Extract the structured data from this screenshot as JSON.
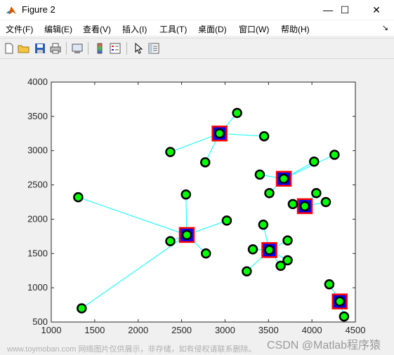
{
  "window": {
    "title": "Figure 2",
    "minimize_glyph": "—",
    "maximize_glyph": "☐",
    "close_glyph": "✕"
  },
  "menu": [
    "文件(F)",
    "编辑(E)",
    "查看(V)",
    "插入(I)",
    "工具(T)",
    "桌面(D)",
    "窗口(W)",
    "帮助(H)"
  ],
  "menu_dock_glyph": "↘",
  "toolbar": [
    "new-figure-icon",
    "open-file-icon",
    "save-icon",
    "print-icon",
    "link-plot-icon",
    "colorbar-icon",
    "legend-icon",
    "pointer-icon",
    "property-editor-icon"
  ],
  "chart_data": {
    "type": "scatter",
    "xlim": [
      1000,
      4500
    ],
    "ylim": [
      500,
      4000
    ],
    "xticks": [
      1000,
      1500,
      2000,
      2500,
      3000,
      3500,
      4000,
      4500
    ],
    "yticks": [
      500,
      1000,
      1500,
      2000,
      2500,
      3000,
      3500,
      4000
    ],
    "grid": false,
    "colors": {
      "point_fill": "#00ff00",
      "point_edge": "#000000",
      "line": "#00ffff",
      "center_fill": "#0000ff",
      "center_edge": "#ff0000"
    },
    "clusters": [
      {
        "center": [
          2937,
          3250
        ],
        "points": [
          [
            3139,
            3550
          ],
          [
            2370,
            2980
          ],
          [
            2772,
            2830
          ],
          [
            3450,
            3210
          ]
        ]
      },
      {
        "center": [
          3676,
          2590
        ],
        "points": [
          [
            3400,
            2650
          ],
          [
            3510,
            2380
          ],
          [
            4025,
            2840
          ],
          [
            4260,
            2940
          ]
        ]
      },
      {
        "center": [
          3918,
          2190
        ],
        "points": [
          [
            3780,
            2220
          ],
          [
            4050,
            2380
          ],
          [
            4160,
            2250
          ]
        ]
      },
      {
        "center": [
          2560,
          1770
        ],
        "points": [
          [
            1310,
            2320
          ],
          [
            1350,
            700
          ],
          [
            2370,
            1680
          ],
          [
            2550,
            2360
          ],
          [
            2780,
            1500
          ],
          [
            3020,
            1980
          ]
        ]
      },
      {
        "center": [
          3510,
          1550
        ],
        "points": [
          [
            3440,
            1920
          ],
          [
            3320,
            1560
          ],
          [
            3250,
            1240
          ],
          [
            3640,
            1320
          ],
          [
            3720,
            1400
          ],
          [
            3720,
            1690
          ]
        ]
      },
      {
        "center": [
          4320,
          800
        ],
        "points": [
          [
            4200,
            1050
          ],
          [
            4370,
            580
          ]
        ]
      }
    ]
  },
  "watermark": "www.toymoban.com 网络图片仅供展示，非存储，如有侵权请联系删除。",
  "watermark2": "CSDN @Matlab程序猿"
}
